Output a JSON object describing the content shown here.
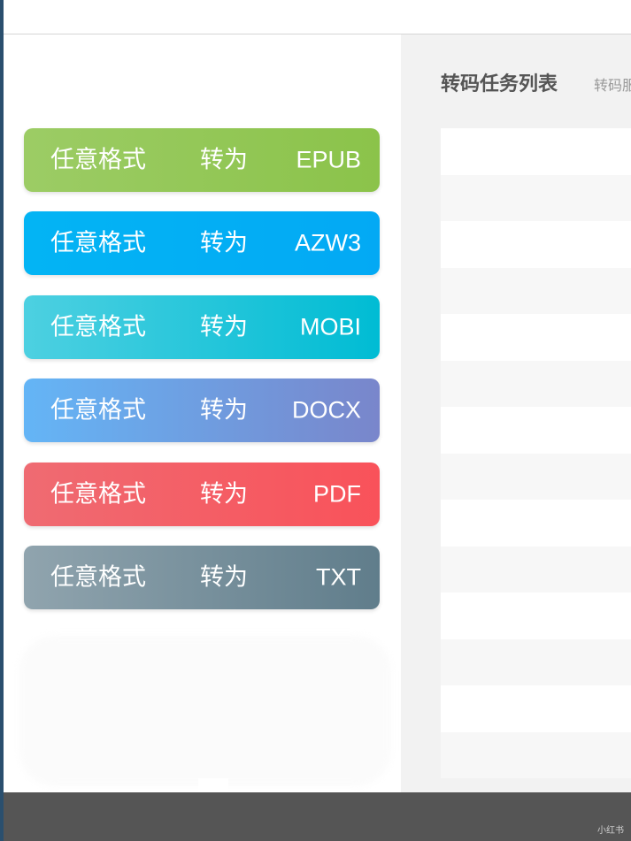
{
  "conversions": [
    {
      "from": "任意格式",
      "to": "转为",
      "format": "EPUB",
      "colors": [
        "#9ccc65",
        "#8bc34a"
      ]
    },
    {
      "from": "任意格式",
      "to": "转为",
      "format": "AZW3",
      "colors": [
        "#03b4f4",
        "#03a9f4"
      ]
    },
    {
      "from": "任意格式",
      "to": "转为",
      "format": "MOBI",
      "colors": [
        "#4dd0e1",
        "#00bcd4"
      ]
    },
    {
      "from": "任意格式",
      "to": "转为",
      "format": "DOCX",
      "colors": [
        "#64b5f6",
        "#7986cb"
      ]
    },
    {
      "from": "任意格式",
      "to": "转为",
      "format": "PDF",
      "colors": [
        "#ef6b72",
        "#f9525a"
      ]
    },
    {
      "from": "任意格式",
      "to": "转为",
      "format": "TXT",
      "colors": [
        "#90a4ae",
        "#607d8b"
      ]
    }
  ],
  "task_panel": {
    "title": "转码任务列表",
    "subtitle": "转码服务"
  },
  "task_rows": [
    "",
    "",
    "",
    "",
    "",
    "",
    "",
    "",
    "",
    "",
    "",
    "",
    "",
    ""
  ],
  "watermark": "小红书"
}
